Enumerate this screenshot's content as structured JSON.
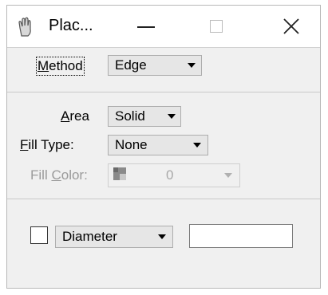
{
  "window": {
    "title": "Plac..."
  },
  "method": {
    "label_prefix": "",
    "label_key": "M",
    "label_rest": "ethod",
    "value": "Edge"
  },
  "area": {
    "label_key": "A",
    "label_rest": "rea",
    "value": "Solid"
  },
  "fill_type": {
    "label_key": "F",
    "label_rest": "ill Type:",
    "value": "None"
  },
  "fill_color": {
    "label_prefix": "Fill ",
    "label_key": "C",
    "label_rest": "olor:",
    "value": "0"
  },
  "diameter": {
    "value": "Diameter",
    "checked": false,
    "text": ""
  },
  "icons": {
    "app": "hand-icon",
    "minimize": "minimize-icon",
    "maximize": "maximize-icon",
    "close": "close-icon"
  }
}
